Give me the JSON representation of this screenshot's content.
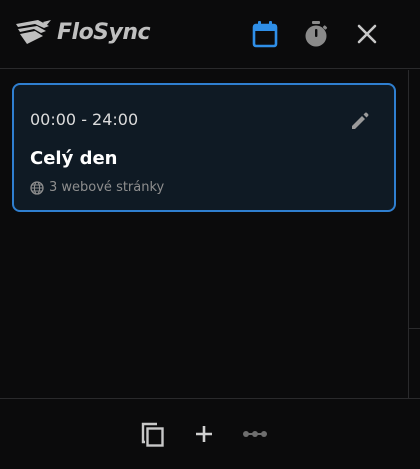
{
  "app": {
    "name": "FloSync"
  },
  "colors": {
    "accent": "#2f7fd0",
    "card_background": "#0f1a24",
    "background": "#0b0b0c"
  },
  "header": {
    "icons": [
      "calendar-icon",
      "timer-icon",
      "close-icon"
    ]
  },
  "schedule": {
    "items": [
      {
        "time_range": "00:00 - 24:00",
        "title": "Celý den",
        "websites": "3 webové stránky",
        "selected": true
      }
    ]
  },
  "footer": {
    "icons": [
      "copy-icon",
      "add-icon",
      "more-icon"
    ]
  }
}
